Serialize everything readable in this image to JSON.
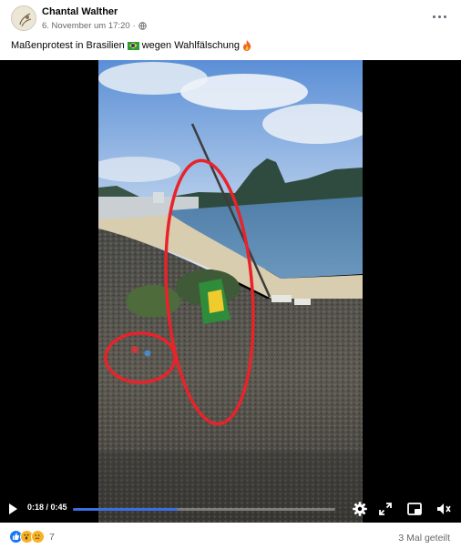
{
  "post": {
    "author": "Chantal Walther",
    "date": "6. November um 17:20",
    "privacy_icon": "globe-icon",
    "caption_before_flag": "Maßenprotest in Brasilien",
    "caption_after_flag": "wegen Wahlfälschung"
  },
  "video": {
    "time": "0:18 / 0:45",
    "progress": 0.4,
    "annotation_color": "#e8232a",
    "icons": [
      "play-icon",
      "settings-icon",
      "fullscreen-icon",
      "miniplayer-icon",
      "volume-icon"
    ]
  },
  "footer": {
    "reaction_count": "7",
    "shares": "3 Mal geteilt",
    "reactions": [
      "like",
      "wow",
      "sad"
    ]
  },
  "colors": {
    "like_blue": "#1877f2",
    "secondary_text": "#65676b",
    "progress": "#3b6fe0"
  }
}
